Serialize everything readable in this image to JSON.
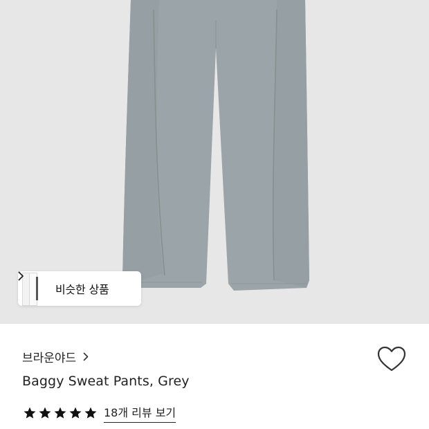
{
  "similar_products": {
    "label": "비슷한 상품"
  },
  "product": {
    "brand": "브라운야드",
    "name": "Baggy Sweat Pants, Grey",
    "rating_stars": 5,
    "reviews_link": "18개 리뷰 보기"
  },
  "icons": {
    "similar_chevron": "chevron-right-icon",
    "brand_chevron": "chevron-right-icon",
    "like": "heart-outline-icon",
    "rating": "star-icon"
  },
  "colors": {
    "image_background": "#e7e7e7",
    "pants_grey": "#9aa3a7",
    "text": "#222222",
    "star": "#111111"
  }
}
